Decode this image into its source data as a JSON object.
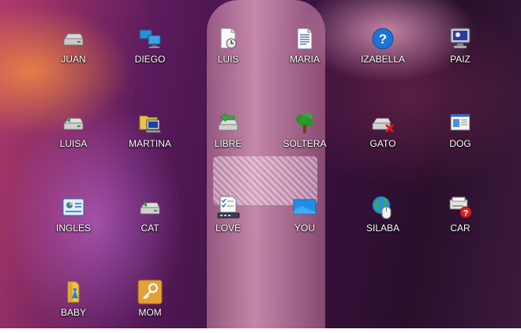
{
  "desktop": {
    "icons": [
      {
        "label": "JUAN",
        "icon": "drive-icon"
      },
      {
        "label": "DIEGO",
        "icon": "network-computers-icon"
      },
      {
        "label": "LUIS",
        "icon": "document-clock-icon"
      },
      {
        "label": "MARIA",
        "icon": "text-document-icon"
      },
      {
        "label": "IZABELLA",
        "icon": "help-icon"
      },
      {
        "label": "PAIZ",
        "icon": "monitor-icon"
      },
      {
        "label": "LUISA",
        "icon": "drive-green-icon"
      },
      {
        "label": "MARTINA",
        "icon": "folder-computer-icon"
      },
      {
        "label": "LIBRE",
        "icon": "drive-arrow-icon"
      },
      {
        "label": "SOLTERA",
        "icon": "tree-icon"
      },
      {
        "label": "GATO",
        "icon": "drive-error-icon"
      },
      {
        "label": "DOG",
        "icon": "window-panel-icon"
      },
      {
        "label": "INGLES",
        "icon": "control-panel-icon"
      },
      {
        "label": "CAT",
        "icon": "drive-green-icon"
      },
      {
        "label": "LOVE",
        "icon": "checklist-icon"
      },
      {
        "label": "YOU",
        "icon": "blue-screen-icon"
      },
      {
        "label": "SILABA",
        "icon": "globe-mouse-icon"
      },
      {
        "label": "CAR",
        "icon": "printer-help-icon"
      },
      {
        "label": "BABY",
        "icon": "folder-user-icon"
      },
      {
        "label": "MOM",
        "icon": "key-icon"
      }
    ]
  }
}
